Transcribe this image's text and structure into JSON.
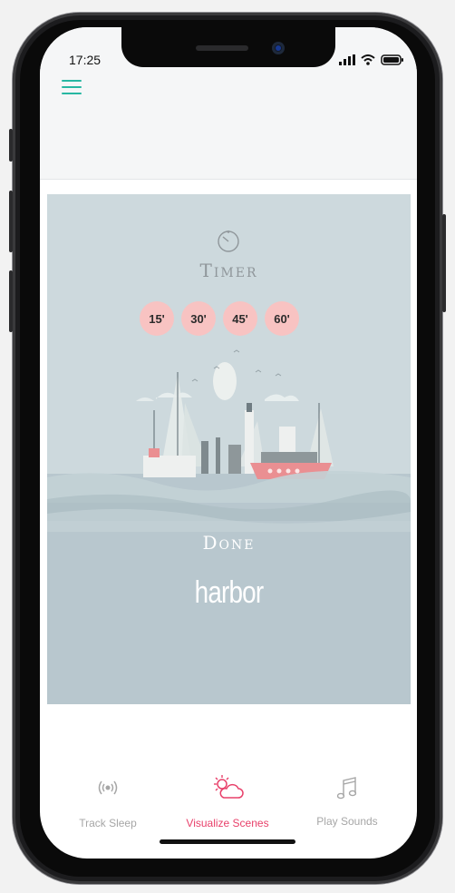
{
  "status_bar": {
    "time": "17:25"
  },
  "header": {
    "menu_icon": "hamburger-menu-icon"
  },
  "timer": {
    "title": "Timer",
    "options": [
      "15'",
      "30'",
      "45'",
      "60'"
    ]
  },
  "scene": {
    "done_label": "Done",
    "brand": "harbor"
  },
  "tabbar": {
    "tabs": [
      {
        "label": "Track Sleep",
        "icon": "broadcast-icon",
        "active": false
      },
      {
        "label": "Visualize Scenes",
        "icon": "weather-scene-icon",
        "active": true
      },
      {
        "label": "Play Sounds",
        "icon": "music-note-icon",
        "active": false
      }
    ]
  },
  "colors": {
    "accent_teal": "#27b7a2",
    "active_tab": "#e8406a",
    "inactive_tab": "#a6a6a6",
    "chip": "#f8c3c2"
  }
}
